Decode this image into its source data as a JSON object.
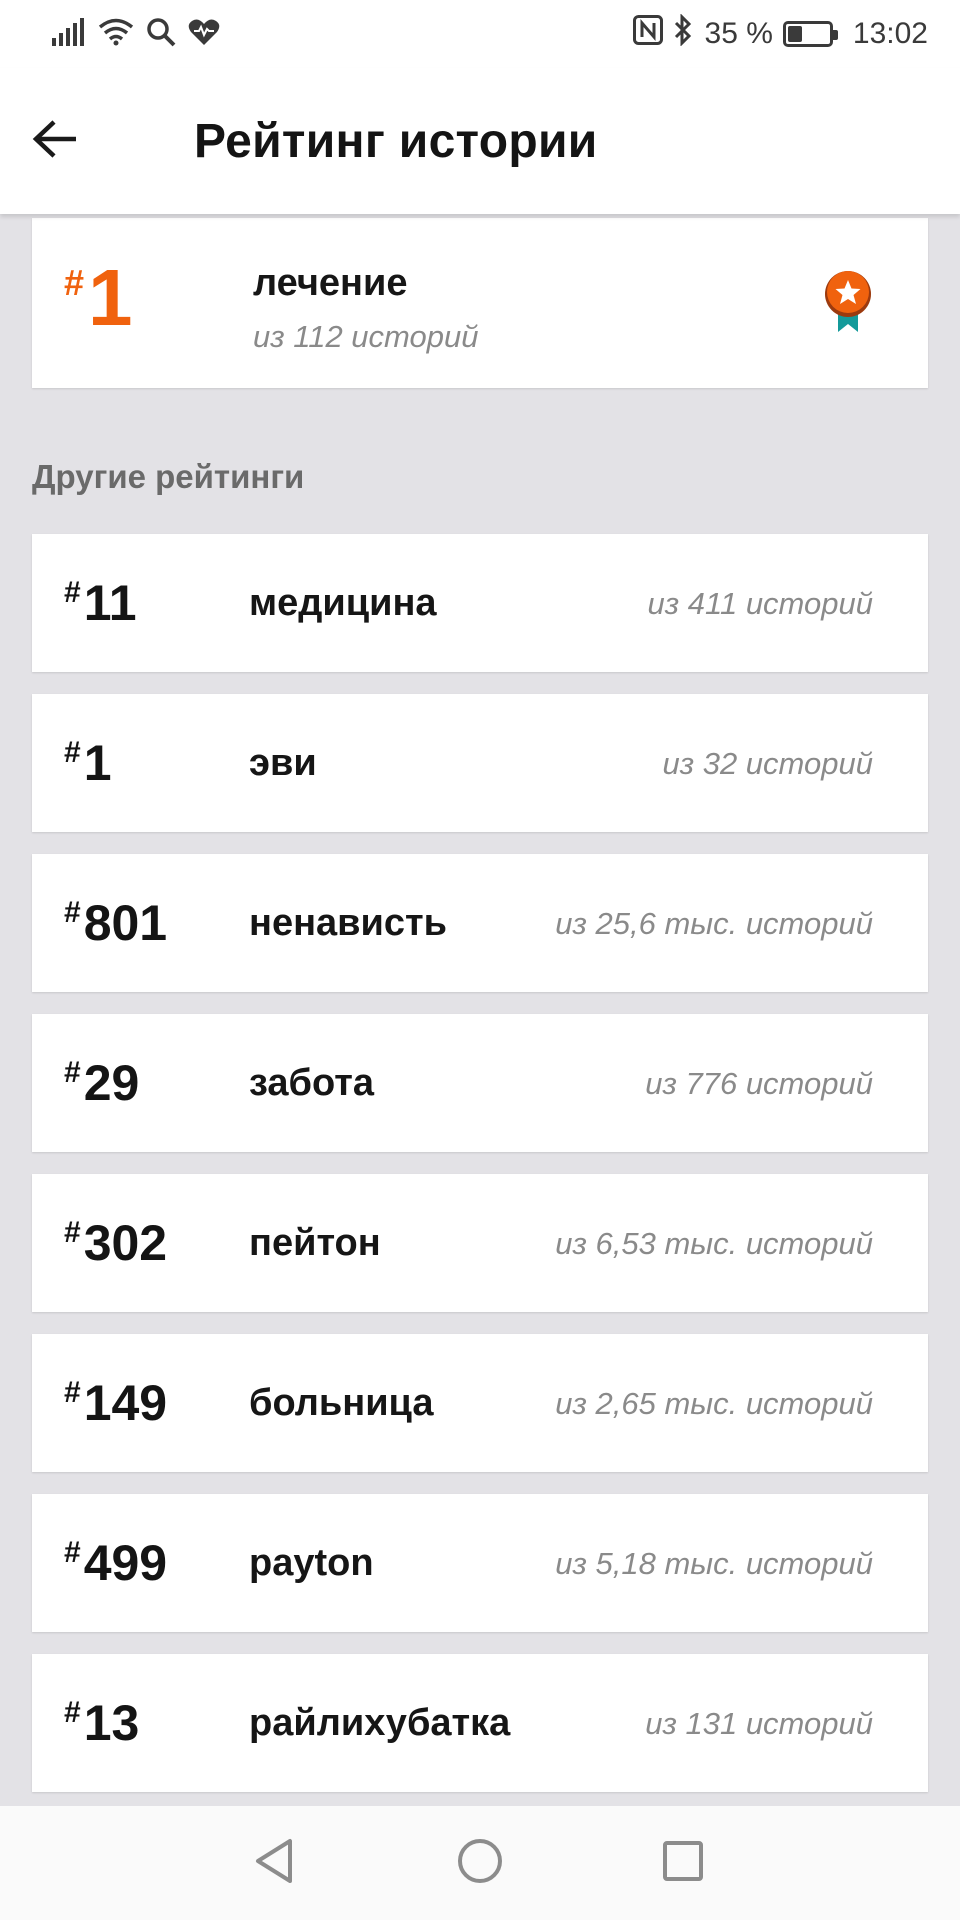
{
  "status_bar": {
    "battery_percent": "35 %",
    "battery_level": 0.35,
    "time": "13:02",
    "icons": [
      "signal-icon",
      "wifi-icon",
      "search-icon",
      "health-icon",
      "nfc-icon",
      "bluetooth-icon",
      "battery-icon"
    ]
  },
  "app_bar": {
    "title": "Рейтинг истории",
    "back_icon": "arrow-left-icon"
  },
  "top_rating": {
    "hash": "#",
    "rank": "1",
    "tag": "лечение",
    "count": "из 112 историй",
    "badge_icon": "medal-star-icon",
    "accent_color": "#f0620e"
  },
  "section_title": "Другие рейтинги",
  "rankings": [
    {
      "hash": "#",
      "rank": "11",
      "tag": "медицина",
      "count": "из 411 историй"
    },
    {
      "hash": "#",
      "rank": "1",
      "tag": "эви",
      "count": "из 32 историй"
    },
    {
      "hash": "#",
      "rank": "801",
      "tag": "ненависть",
      "count": "из 25,6 тыс. историй"
    },
    {
      "hash": "#",
      "rank": "29",
      "tag": "забота",
      "count": "из 776 историй"
    },
    {
      "hash": "#",
      "rank": "302",
      "tag": "пейтон",
      "count": "из 6,53 тыс. историй"
    },
    {
      "hash": "#",
      "rank": "149",
      "tag": "больница",
      "count": "из 2,65 тыс. историй"
    },
    {
      "hash": "#",
      "rank": "499",
      "tag": "payton",
      "count": "из 5,18 тыс. историй"
    },
    {
      "hash": "#",
      "rank": "13",
      "tag": "райлихубатка",
      "count": "из 131 историй"
    }
  ],
  "nav_bar": {
    "icons": [
      "back-triangle-icon",
      "home-circle-icon",
      "recents-square-icon"
    ]
  }
}
